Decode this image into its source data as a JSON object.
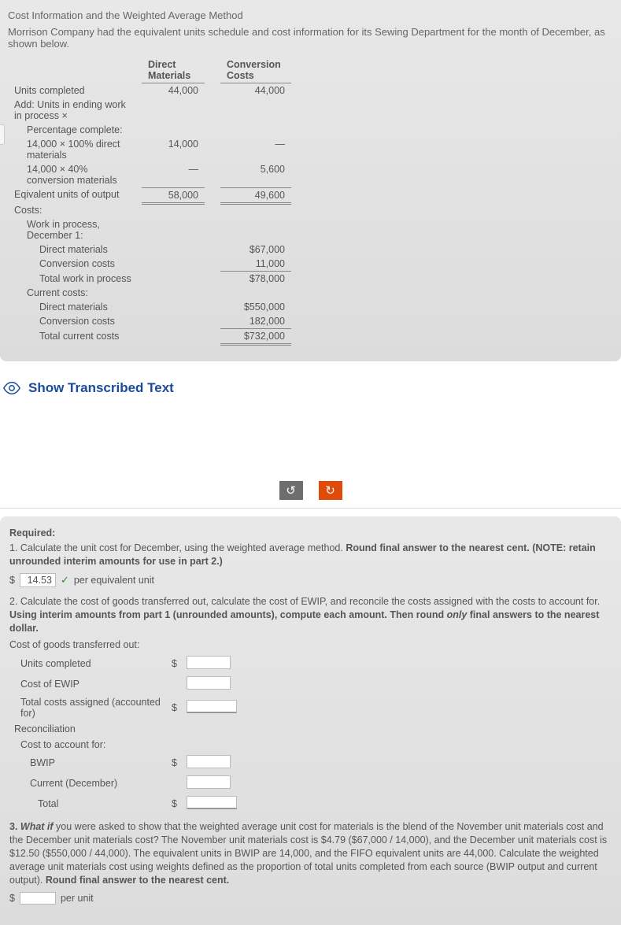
{
  "top": {
    "title": "Cost Information and the Weighted Average Method",
    "subtitle": "Morrison Company had the equivalent units schedule and cost information for its Sewing Department for the month of December, as shown below.",
    "headers": {
      "dm": "Direct Materials",
      "cc": "Conversion Costs"
    },
    "rows": {
      "units_completed": {
        "label": "Units completed",
        "dm": "44,000",
        "cc": "44,000"
      },
      "add_ewip": "Add: Units in ending work in process ×",
      "pct_complete": "Percentage complete:",
      "dm_line": {
        "label": "14,000 × 100% direct materials",
        "dm": "14,000",
        "cc": "—"
      },
      "cc_line": {
        "label": "14,000 × 40% conversion materials",
        "dm": "—",
        "cc": "5,600"
      },
      "equiv": {
        "label": "Eqivalent units of output",
        "dm": "58,000",
        "cc": "49,600"
      },
      "costs": "Costs:",
      "wip_dec1": "Work in process, December 1:",
      "wip_dm": {
        "label": "Direct materials",
        "cc": "$67,000"
      },
      "wip_cc": {
        "label": "Conversion costs",
        "cc": "11,000"
      },
      "wip_total": {
        "label": "Total work in process",
        "cc": "$78,000"
      },
      "cur_costs": "Current costs:",
      "cur_dm": {
        "label": "Direct materials",
        "cc": "$550,000"
      },
      "cur_cc": {
        "label": "Conversion costs",
        "cc": "182,000"
      },
      "cur_total": {
        "label": "Total current costs",
        "cc": "$732,000"
      }
    }
  },
  "transcribed": "Show Transcribed Text",
  "buttons": {
    "undo": "↺",
    "redo": "↻"
  },
  "bottom": {
    "required": "Required:",
    "q1": "1. Calculate the unit cost for December, using the weighted average method. Round final answer to the nearest cent. (NOTE: retain unrounded interim amounts for use in part 2.)",
    "q1_prefix": "$",
    "q1_value": "14.53",
    "q1_suffix": "per equivalent unit",
    "q2": "2. Calculate the cost of goods transferred out, calculate the cost of EWIP, and reconcile the costs assigned with the costs to account for. Using interim amounts from part 1 (unrounded amounts), compute each amount. Then round only final answers to the nearest dollar.",
    "cogt_label": "Cost of goods transferred out:",
    "units_completed": "Units completed",
    "cost_ewip": "Cost of EWIP",
    "total_assigned": "Total costs assigned (accounted for)",
    "reconciliation": "Reconciliation",
    "cost_to_account": "Cost to account for:",
    "bwip": "BWIP",
    "current_dec": "Current (December)",
    "total": "Total",
    "q3_pre": "3. ",
    "q3_whatif": "What if",
    "q3_body": " you were asked to show that the weighted average unit cost for materials is the blend of the November unit materials cost and the December unit materials cost? The November unit materials cost is $4.79 ($67,000 / 14,000), and the December unit materials cost is $12.50 ($550,000 / 44,000). The equivalent units in BWIP are 14,000, and the FIFO equivalent units are 44,000. Calculate the weighted average unit materials cost using weights defined as the proportion of total units completed from each source (BWIP output and current output). ",
    "q3_round": "Round final answer to the nearest cent.",
    "q3_prefix": "$",
    "q3_suffix": "per unit"
  }
}
